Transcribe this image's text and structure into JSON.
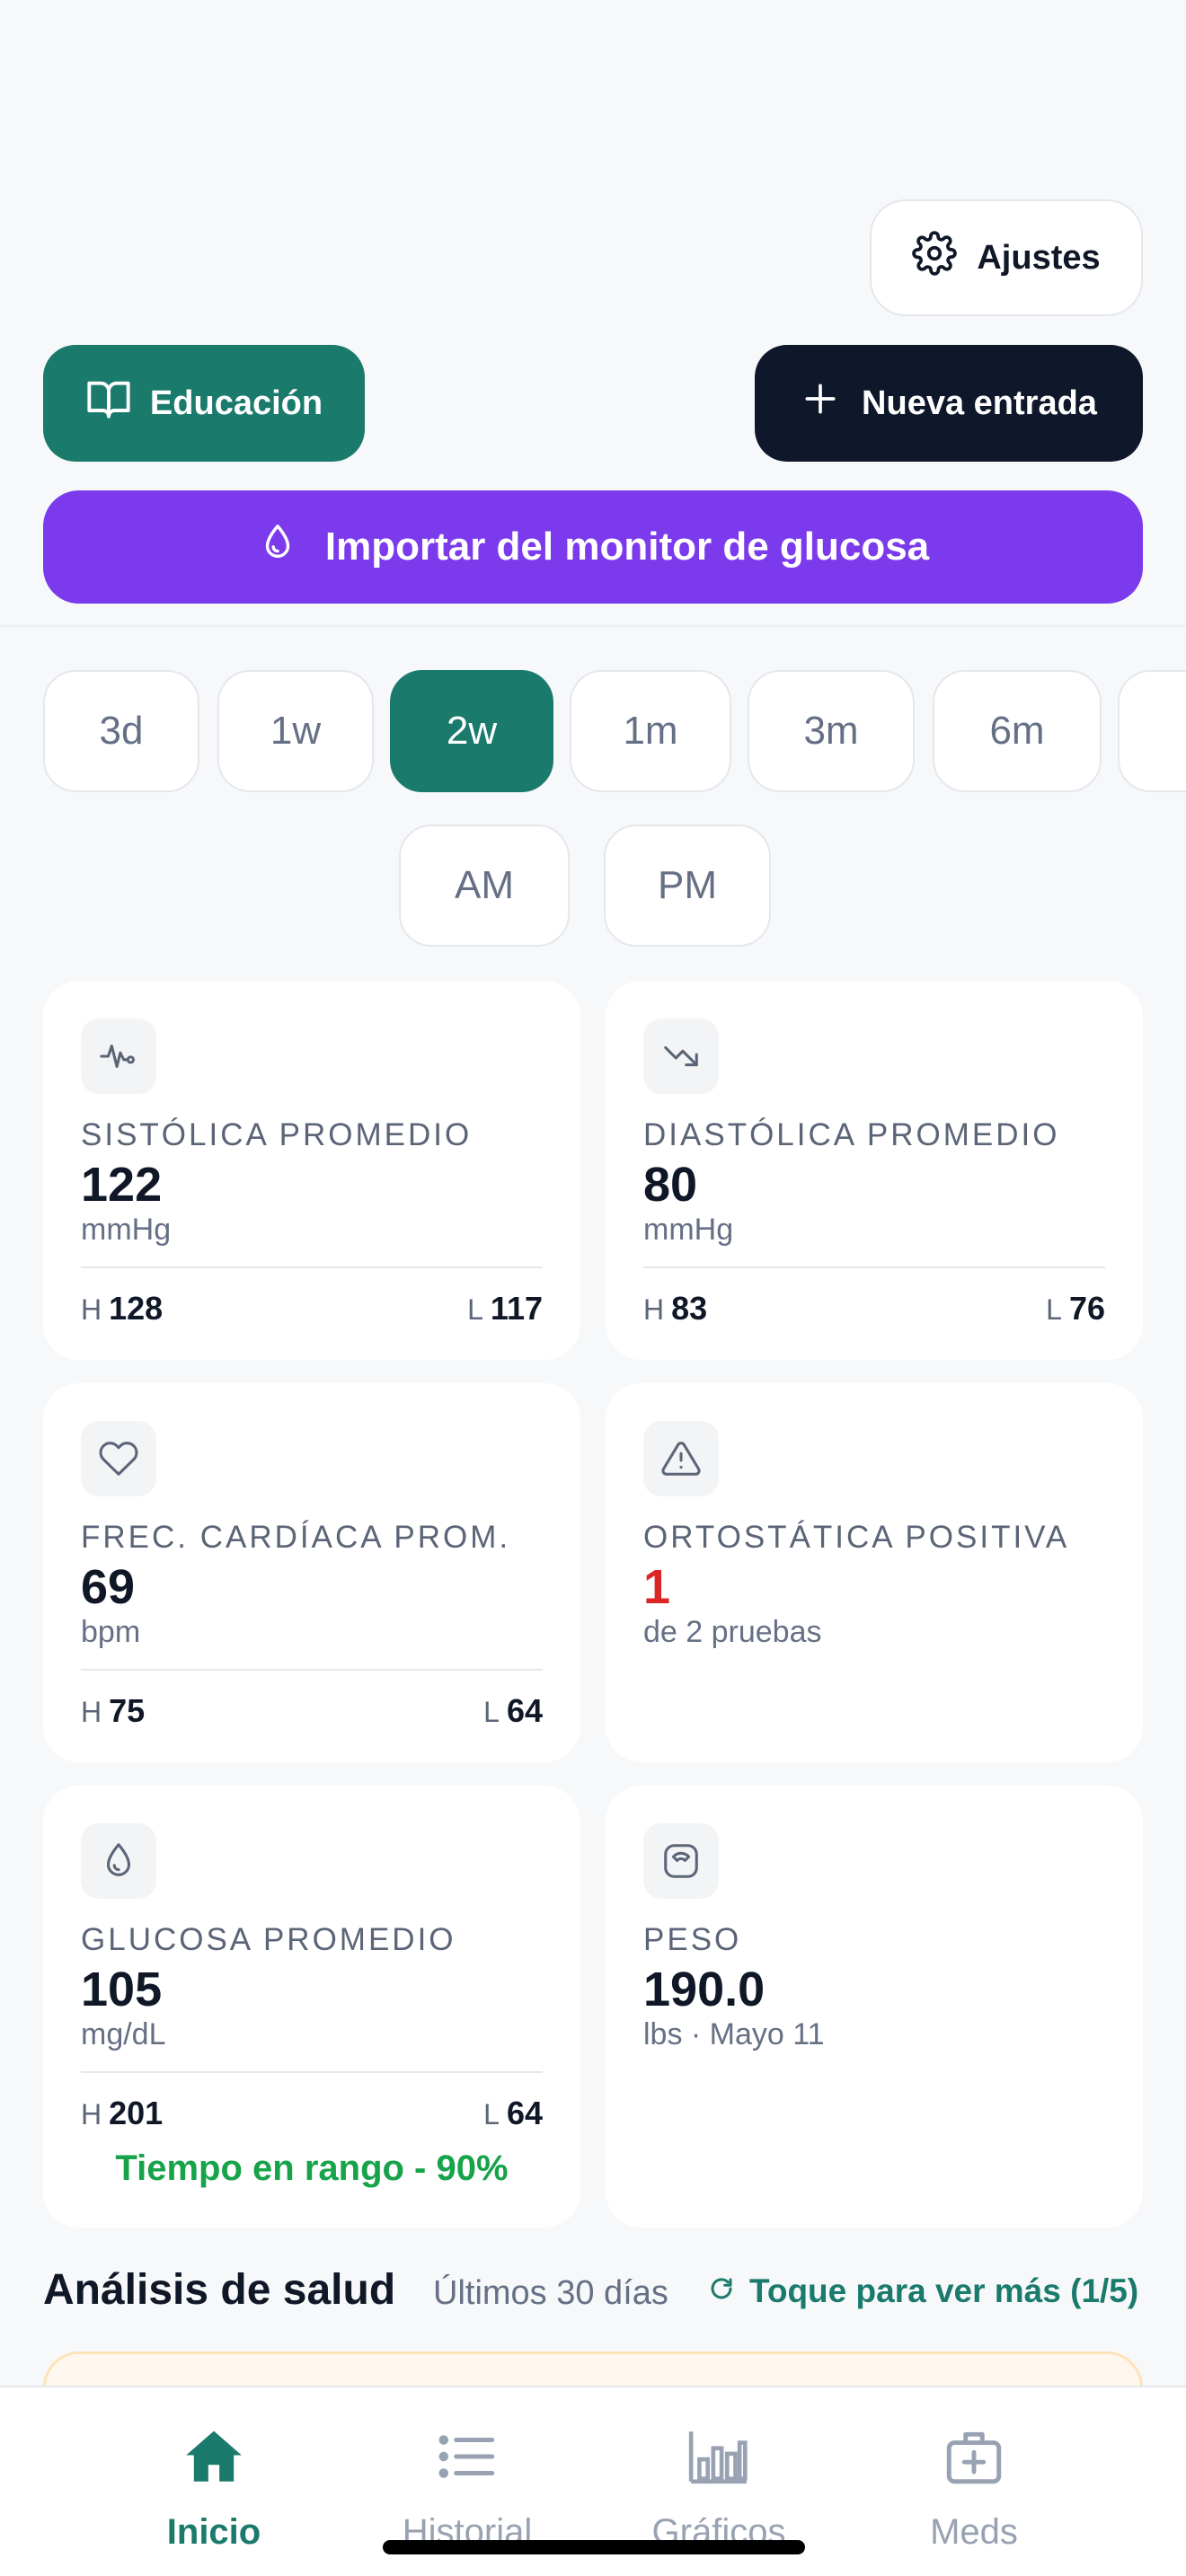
{
  "header": {
    "settings_label": "Ajustes",
    "education_label": "Educación",
    "new_entry_label": "Nueva entrada",
    "import_label": "Importar del monitor de glucosa"
  },
  "ranges": [
    "3d",
    "1w",
    "2w",
    "1m",
    "3m",
    "6m"
  ],
  "selected_range": "2w",
  "time_of_day": [
    "AM",
    "PM"
  ],
  "cards": {
    "systolic": {
      "label": "SISTÓLICA PROMEDIO",
      "value": "122",
      "unit": "mmHg",
      "high_key": "H",
      "high": "128",
      "low_key": "L",
      "low": "117",
      "icon": "activity-icon"
    },
    "diastolic": {
      "label": "DIASTÓLICA PROMEDIO",
      "value": "80",
      "unit": "mmHg",
      "high_key": "H",
      "high": "83",
      "low_key": "L",
      "low": "76",
      "icon": "trending-down-icon"
    },
    "heart_rate": {
      "label": "FREC. CARDÍACA PROM.",
      "value": "69",
      "unit": "bpm",
      "high_key": "H",
      "high": "75",
      "low_key": "L",
      "low": "64",
      "icon": "heart-icon"
    },
    "orthostatic": {
      "label": "ORTOSTÁTICA POSITIVA",
      "value": "1",
      "unit": "de 2 pruebas",
      "icon": "warning-icon",
      "value_color": "#dc2626"
    },
    "glucose": {
      "label": "GLUCOSA PROMEDIO",
      "value": "105",
      "unit": "mg/dL",
      "high_key": "H",
      "high": "201",
      "low_key": "L",
      "low": "64",
      "time_in_range": "Tiempo en rango - 90%",
      "icon": "droplet-icon"
    },
    "weight": {
      "label": "PESO",
      "value": "190.0",
      "unit": "lbs · Mayo 11",
      "icon": "scale-icon"
    }
  },
  "analysis": {
    "title": "Análisis de salud",
    "subtitle": "Últimos 30 días",
    "more_label": "Toque para ver más (1/5)"
  },
  "tabs": [
    {
      "label": "Inicio",
      "icon": "home-icon",
      "active": true
    },
    {
      "label": "Historial",
      "icon": "list-icon",
      "active": false
    },
    {
      "label": "Gráficos",
      "icon": "bar-chart-icon",
      "active": false
    },
    {
      "label": "Meds",
      "icon": "medkit-icon",
      "active": false
    }
  ],
  "colors": {
    "teal": "#1a7a6c",
    "navy": "#0f172a",
    "purple": "#7c3aed",
    "green": "#16a34a",
    "red": "#dc2626"
  }
}
